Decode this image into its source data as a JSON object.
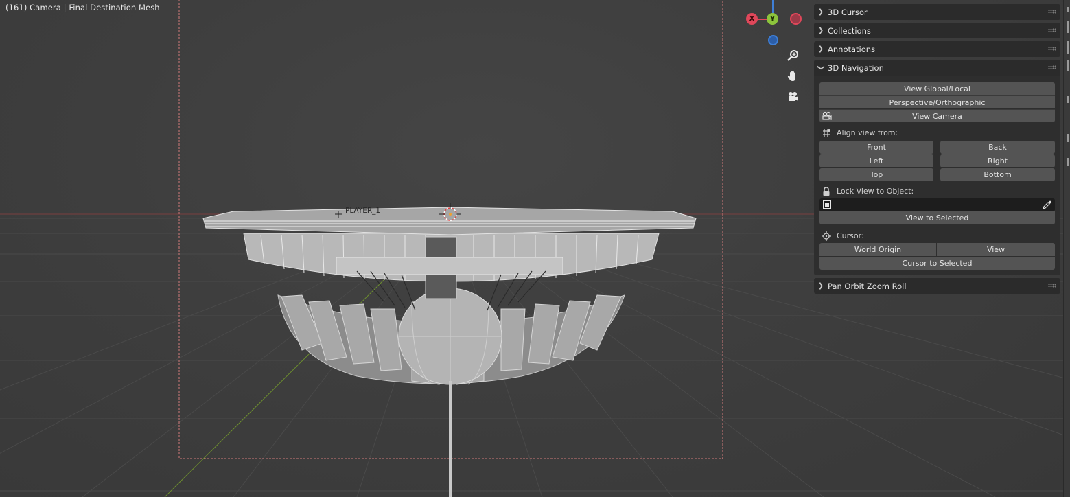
{
  "viewport": {
    "view_label": "(161) Camera | Final Destination Mesh",
    "object_label": "PLAYER_1"
  },
  "gizmo": {
    "x_label": "X",
    "y_label": "Y",
    "x_color": "#e0475a",
    "y_color": "#8cc43c",
    "z_color": "#3f7fd6"
  },
  "nav_icons": [
    "zoom-icon",
    "hand-pan-icon",
    "camera-icon"
  ],
  "panels": [
    {
      "label": "3D Cursor",
      "collapsed": true
    },
    {
      "label": "Collections",
      "collapsed": true
    },
    {
      "label": "Annotations",
      "collapsed": true
    },
    {
      "label": "3D Navigation",
      "collapsed": false
    },
    {
      "label": "Pan Orbit Zoom Roll",
      "collapsed": true
    }
  ],
  "navigation": {
    "view_global_local": "View Global/Local",
    "perspective_orthographic": "Perspective/Orthographic",
    "view_camera": "View Camera",
    "align_view_from": "Align view from:",
    "front": "Front",
    "back": "Back",
    "left": "Left",
    "right": "Right",
    "top": "Top",
    "bottom": "Bottom",
    "lock_view_to_object": "Lock View to Object:",
    "lock_object_value": "",
    "view_to_selected": "View to Selected",
    "cursor": "Cursor:",
    "world_origin": "World Origin",
    "view": "View",
    "cursor_to_selected": "Cursor to Selected"
  },
  "colors": {
    "accent_dash": "#e08080",
    "panel_bg": "#2e2e2e",
    "button_bg": "#545454"
  }
}
